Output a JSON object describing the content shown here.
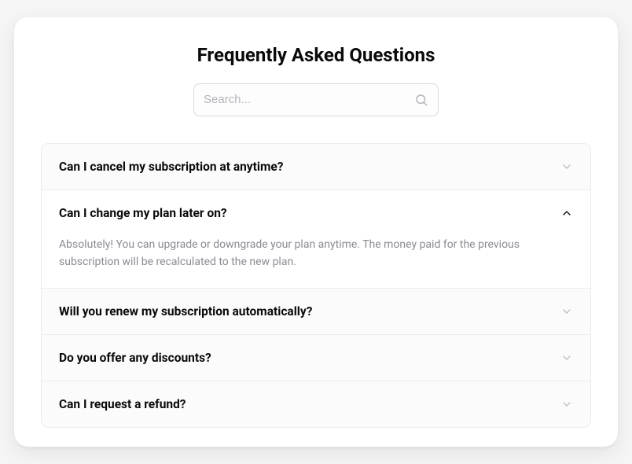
{
  "title": "Frequently Asked Questions",
  "search": {
    "placeholder": "Search..."
  },
  "faq": [
    {
      "question": "Can I cancel my subscription at anytime?",
      "answer": "",
      "expanded": false
    },
    {
      "question": "Can I change my plan later on?",
      "answer": "Absolutely! You can upgrade or downgrade your plan anytime. The money paid for the previous subscription will be recalculated to the new plan.",
      "expanded": true
    },
    {
      "question": "Will you renew my subscription automatically?",
      "answer": "",
      "expanded": false
    },
    {
      "question": "Do you offer any discounts?",
      "answer": "",
      "expanded": false
    },
    {
      "question": "Can I request a refund?",
      "answer": "",
      "expanded": false
    }
  ]
}
